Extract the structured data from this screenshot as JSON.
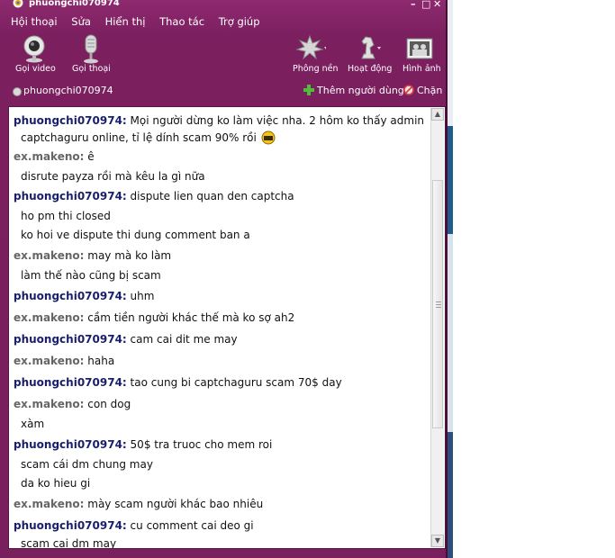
{
  "window": {
    "title": "phuongchi070974",
    "controls": [
      "minimize-icon",
      "maximize-icon",
      "close-icon"
    ]
  },
  "menu": [
    "Hội thoại",
    "Sửa",
    "Hiển thị",
    "Thao tác",
    "Trợ giúp"
  ],
  "toolbar": {
    "video_call": "Gọi video",
    "voice_call": "Gọi thoại",
    "background": "Phông nền",
    "activity": "Hoạt động",
    "photo": "Hình ảnh"
  },
  "contact": {
    "name": "phuongchi070974",
    "add_user": "Thêm người dùng",
    "block": "Chặn"
  },
  "messages": [
    {
      "sender": "phuongchi070974:",
      "sender_color": "#1a1f6b",
      "lines": [
        "Mọi người dừng ko làm việc nha. 2 hôm ko thấy admin",
        "captchaguru online, tỉ lệ dính scam 90% rồi"
      ],
      "emoticon": true
    },
    {
      "sender": "ex.makeno:",
      "sender_color": "#666666",
      "lines": [
        "ê",
        "disrute payza rồi mà kêu la gì nữa"
      ]
    },
    {
      "sender": "phuongchi070974:",
      "sender_color": "#1a1f6b",
      "lines": [
        "dispute lien quan den captcha",
        "ho pm thi closed",
        "ko hoi ve dispute thi dung comment ban a"
      ]
    },
    {
      "sender": "ex.makeno:",
      "sender_color": "#666666",
      "lines": [
        "may mà ko làm",
        "làm thế nào cũng bị scam"
      ]
    },
    {
      "sender": "phuongchi070974:",
      "sender_color": "#1a1f6b",
      "lines": [
        "uhm"
      ]
    },
    {
      "sender": "ex.makeno:",
      "sender_color": "#666666",
      "lines": [
        "cầm tiền người khác thế mà ko sợ ah2"
      ]
    },
    {
      "sender": "phuongchi070974:",
      "sender_color": "#1a1f6b",
      "lines": [
        "cam cai dit me may"
      ]
    },
    {
      "sender": "ex.makeno:",
      "sender_color": "#666666",
      "lines": [
        "haha"
      ]
    },
    {
      "sender": "phuongchi070974:",
      "sender_color": "#1a1f6b",
      "lines": [
        "tao cung bi captchaguru scam 70$ day"
      ]
    },
    {
      "sender": "ex.makeno:",
      "sender_color": "#666666",
      "lines": [
        "con dog",
        "xàm"
      ]
    },
    {
      "sender": "phuongchi070974:",
      "sender_color": "#1a1f6b",
      "lines": [
        "50$ tra truoc cho mem roi",
        "scam cái dm chung may",
        "da ko hieu gi"
      ]
    },
    {
      "sender": "ex.makeno:",
      "sender_color": "#666666",
      "lines": [
        "mày scam người khác bao nhiêu"
      ]
    },
    {
      "sender": "phuongchi070974:",
      "sender_color": "#1a1f6b",
      "lines": [
        "cu comment cai deo gi",
        "scam cai dm may"
      ]
    }
  ],
  "colors": {
    "window_bg": "#7a1f5e",
    "chat_bg": "#ffffff",
    "sender_self": "#1a1f6b",
    "sender_other": "#666666"
  }
}
